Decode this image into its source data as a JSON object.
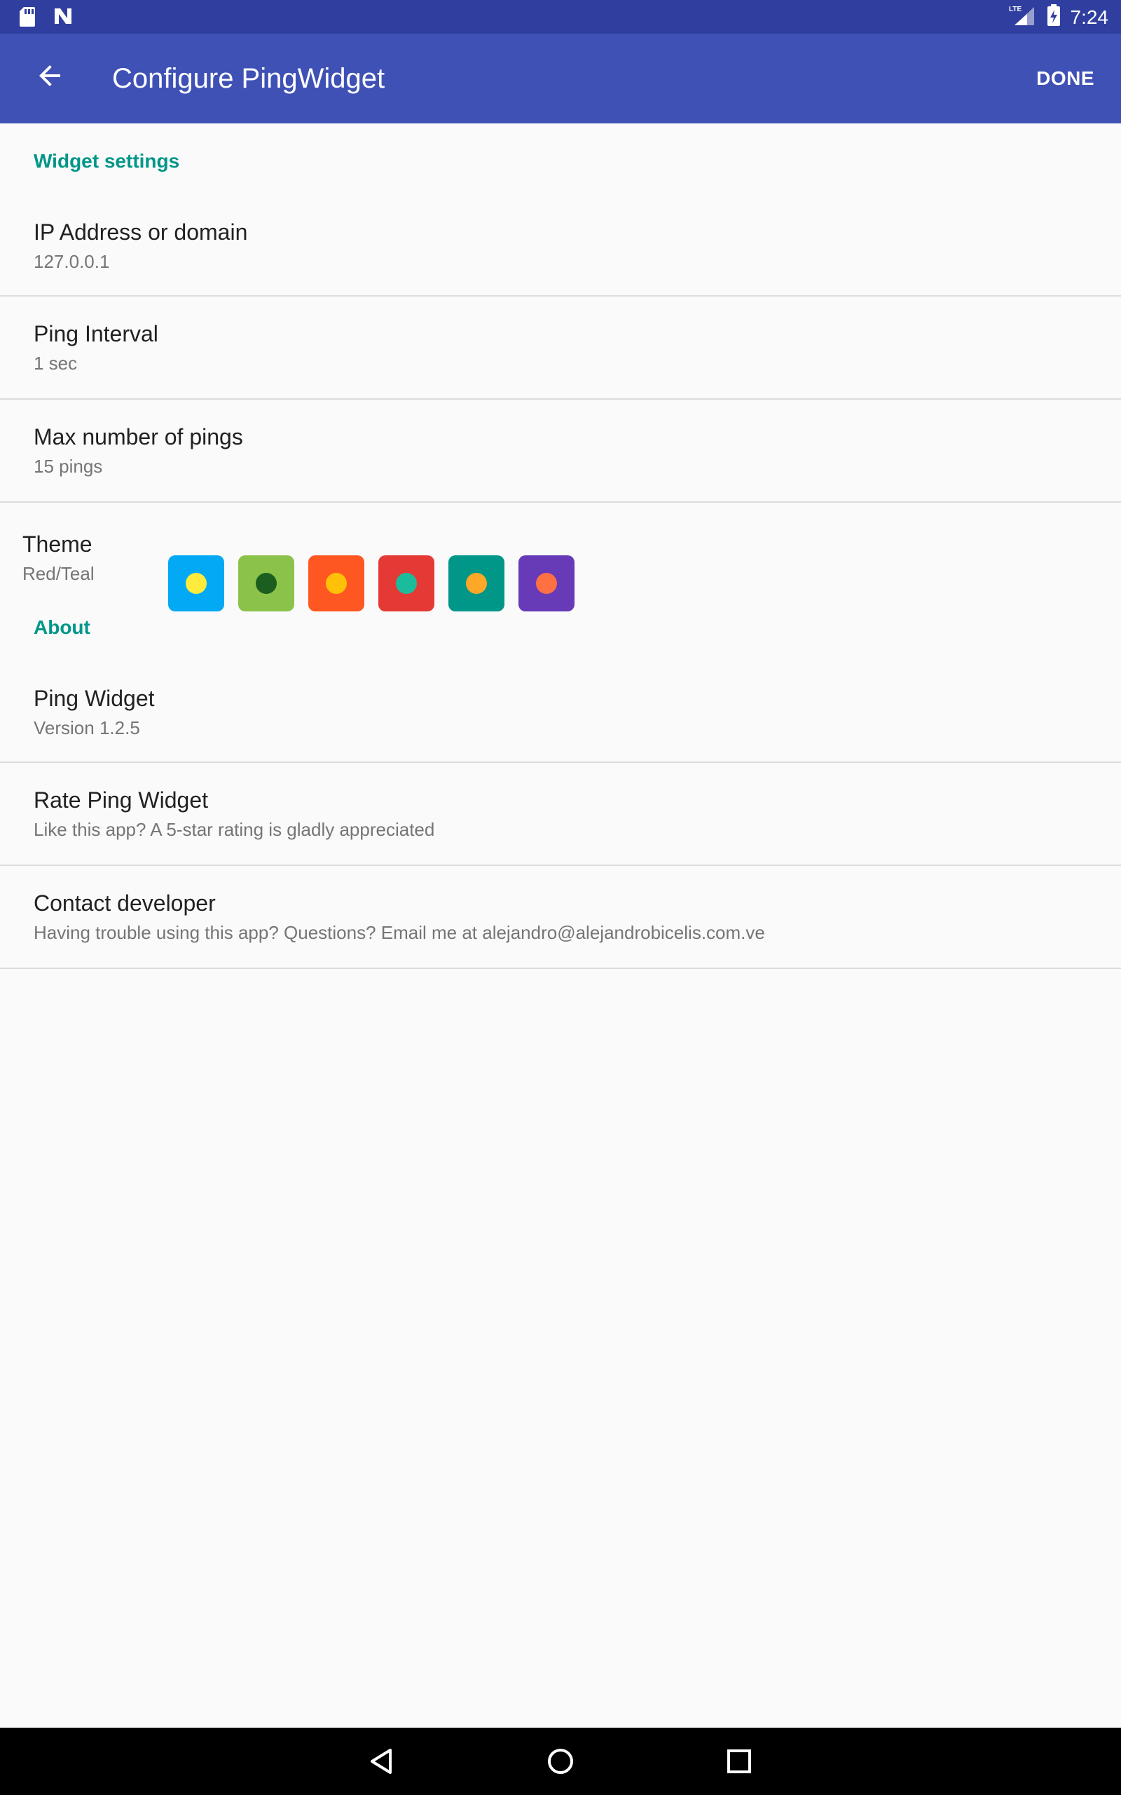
{
  "status_bar": {
    "time": "7:24",
    "network_label": "LTE",
    "left_icons": [
      "sd-card-icon",
      "n-logo-icon"
    ],
    "right_icons": [
      "lte-signal-icon",
      "battery-charging-icon"
    ]
  },
  "toolbar": {
    "title": "Configure PingWidget",
    "done_label": "DONE",
    "back_icon": "arrow-back-icon"
  },
  "widget_settings": {
    "header": "Widget settings",
    "items": [
      {
        "title": "IP Address or domain",
        "summary": "127.0.0.1"
      },
      {
        "title": "Ping Interval",
        "summary": "1 sec"
      },
      {
        "title": "Max number of pings",
        "summary": "15 pings"
      }
    ],
    "theme": {
      "title": "Theme",
      "summary": "Red/Teal",
      "swatches": [
        {
          "bg": "#03a9f4",
          "dot": "#ffeb3b"
        },
        {
          "bg": "#8bc34a",
          "dot": "#1b5e20"
        },
        {
          "bg": "#ff5722",
          "dot": "#ffc107"
        },
        {
          "bg": "#e53935",
          "dot": "#1abc9c"
        },
        {
          "bg": "#009688",
          "dot": "#ffa726"
        },
        {
          "bg": "#673ab7",
          "dot": "#ff7043"
        }
      ]
    }
  },
  "about": {
    "header": "About",
    "items": [
      {
        "title": "Ping Widget",
        "summary": "Version 1.2.5"
      },
      {
        "title": "Rate Ping Widget",
        "summary": "Like this app? A 5-star rating is gladly appreciated"
      },
      {
        "title": "Contact developer",
        "summary": "Having trouble using this app? Questions? Email me at alejandro@alejandrobicelis.com.ve"
      }
    ]
  },
  "nav_bar": {
    "icons": [
      "back-triangle-icon",
      "home-circle-icon",
      "recents-square-icon"
    ]
  },
  "colors": {
    "status_bar": "#303f9f",
    "toolbar": "#3f51b5",
    "accent": "#009688",
    "background": "#fafafa"
  }
}
